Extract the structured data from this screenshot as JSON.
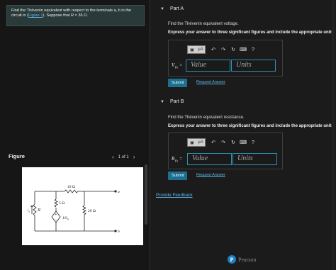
{
  "problem": {
    "text_before": "Find the Thévenin equivalent with respect to the terminals a, b in the circuit in (",
    "link": "Figure 1",
    "text_after": "). Suppose that R = 36 Ω."
  },
  "figure": {
    "label": "Figure",
    "pager": "1 of 1",
    "prev": "‹",
    "next": "›",
    "circuit": {
      "r_top": "10 Ω",
      "r_mid": "5 Ω",
      "r_right": "20 Ω",
      "r_left": "R",
      "source": "10i",
      "source_sub": "a",
      "current": "i",
      "current_sub": "a",
      "node_a": "a",
      "node_b": "b"
    }
  },
  "partA": {
    "title": "Part A",
    "question": "Find the Thévenin equivalent voltage.",
    "instruction": "Express your answer to three significant figures and include the appropriate units.",
    "var": "V",
    "var_sub": "Th",
    "equals": "=",
    "value_placeholder": "Value",
    "units_placeholder": "Units",
    "submit": "Submit",
    "request": "Request Answer"
  },
  "partB": {
    "title": "Part B",
    "question": "Find the Thévenin equivalent resistance.",
    "instruction": "Express your answer to three significant figures and include the appropriate units.",
    "var": "R",
    "var_sub": "Th",
    "equals": "=",
    "value_placeholder": "Value",
    "units_placeholder": "Units",
    "submit": "Submit",
    "request": "Request Answer"
  },
  "toolbar": {
    "units_label": "μA",
    "help": "?"
  },
  "feedback": "Provide Feedback",
  "brand": "Pearson",
  "brand_glyph": "P"
}
